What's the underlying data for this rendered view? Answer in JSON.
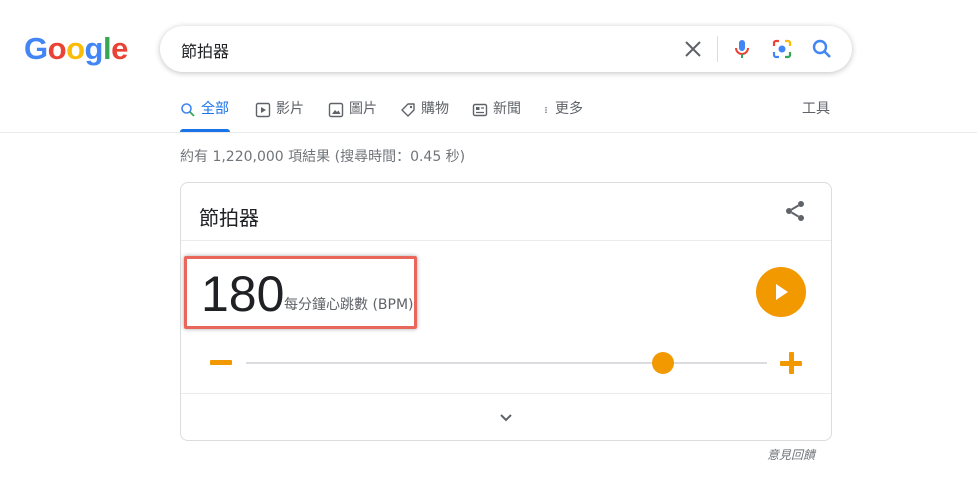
{
  "logo": {
    "letters": [
      "G",
      "o",
      "o",
      "g",
      "l",
      "e"
    ],
    "colors": [
      "#4285f4",
      "#ea4335",
      "#fbbc05",
      "#4285f4",
      "#34a853",
      "#ea4335"
    ]
  },
  "search": {
    "query": "節拍器"
  },
  "tabs": [
    {
      "label": "全部",
      "icon": "search-icon",
      "active": true
    },
    {
      "label": "影片",
      "icon": "play-square-icon"
    },
    {
      "label": "圖片",
      "icon": "image-icon"
    },
    {
      "label": "購物",
      "icon": "tag-icon"
    },
    {
      "label": "新聞",
      "icon": "news-icon"
    },
    {
      "label": "更多",
      "icon": "more-vertical-icon"
    }
  ],
  "tools_label": "工具",
  "result_stats": "約有 1,220,000 項結果 (搜尋時間：0.45 秒)",
  "metronome": {
    "title": "節拍器",
    "bpm": "180",
    "unit": "每分鐘心跳數 (BPM)",
    "slider_fraction": 0.8,
    "accent_color": "#f29900"
  },
  "feedback_label": "意見回饋",
  "colors": {
    "active_tab": "#1a73e8",
    "highlight_box": "#e8665a"
  }
}
